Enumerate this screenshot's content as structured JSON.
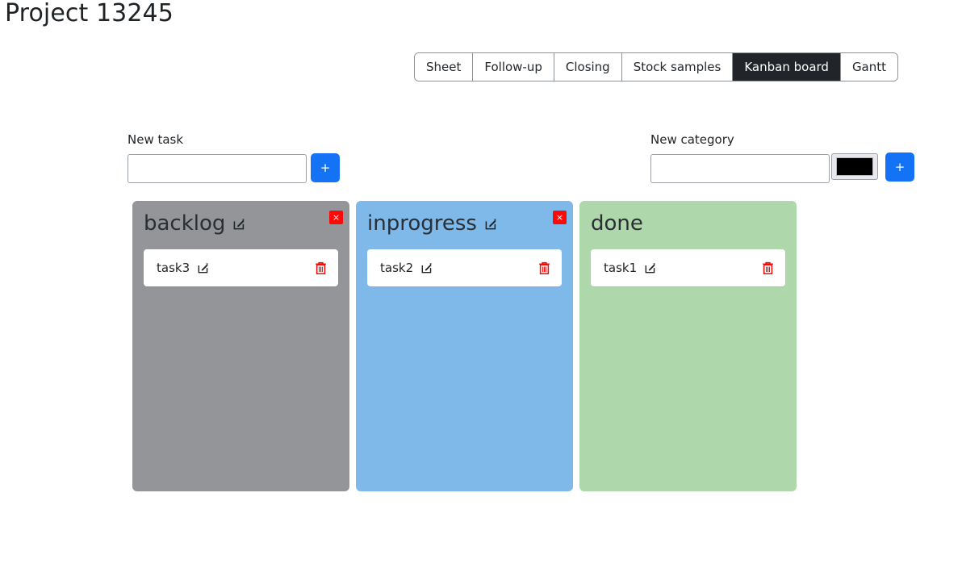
{
  "page": {
    "title": "Project 13245"
  },
  "tabs": [
    {
      "label": "Sheet",
      "active": false
    },
    {
      "label": "Follow-up",
      "active": false
    },
    {
      "label": "Closing",
      "active": false
    },
    {
      "label": "Stock samples",
      "active": false
    },
    {
      "label": "Kanban board",
      "active": true
    },
    {
      "label": "Gantt",
      "active": false
    }
  ],
  "forms": {
    "new_task": {
      "label": "New task",
      "input_value": "",
      "input_placeholder": "",
      "add_button_label": "+"
    },
    "new_category": {
      "label": "New category",
      "input_value": "",
      "input_placeholder": "",
      "color_value": "#000000",
      "add_button_label": "+"
    }
  },
  "board": {
    "columns": [
      {
        "title": "backlog",
        "color": "#939598",
        "has_edit": true,
        "has_close": true,
        "close_label": "×",
        "cards": [
          {
            "label": "task3"
          }
        ]
      },
      {
        "title": "inprogress",
        "color": "#7eb9ea",
        "has_edit": true,
        "has_close": true,
        "close_label": "×",
        "cards": [
          {
            "label": "task2"
          }
        ]
      },
      {
        "title": "done",
        "color": "#aed7ab",
        "has_edit": false,
        "has_close": false,
        "close_label": "×",
        "cards": [
          {
            "label": "task1"
          }
        ]
      }
    ]
  },
  "colors": {
    "accent_blue": "#1473f5",
    "danger_red": "#fb0a07",
    "active_tab_bg": "#212529"
  }
}
